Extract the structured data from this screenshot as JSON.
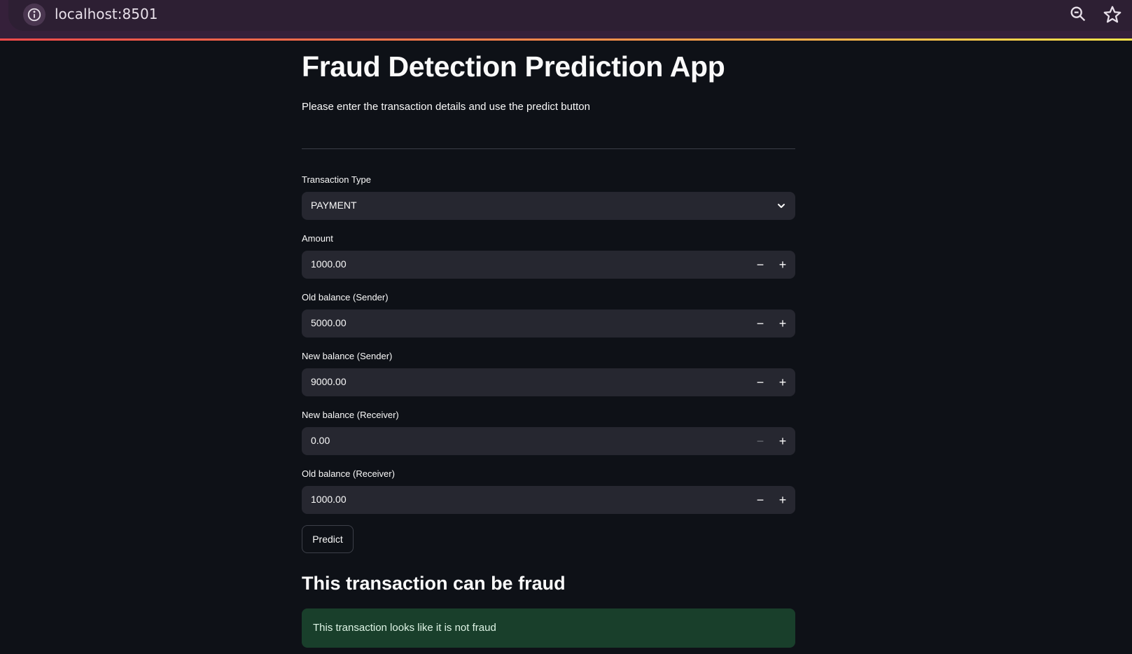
{
  "browser": {
    "url": "localhost:8501"
  },
  "page": {
    "title": "Fraud Detection Prediction App",
    "subtitle": "Please enter the transaction details and use the predict button"
  },
  "form": {
    "transaction_type": {
      "label": "Transaction Type",
      "value": "PAYMENT"
    },
    "amount": {
      "label": "Amount",
      "value": "1000.00"
    },
    "old_balance_sender": {
      "label": "Old balance (Sender)",
      "value": "5000.00"
    },
    "new_balance_sender": {
      "label": "New balance (Sender)",
      "value": "9000.00"
    },
    "new_balance_receiver": {
      "label": "New balance (Receiver)",
      "value": "0.00"
    },
    "old_balance_receiver": {
      "label": "Old balance (Receiver)",
      "value": "1000.00"
    },
    "stepper_minus": "−",
    "stepper_plus": "+"
  },
  "actions": {
    "predict_label": "Predict"
  },
  "result": {
    "heading": "This transaction can be fraud",
    "message": "This transaction looks like it is not fraud"
  },
  "colors": {
    "background": "#0e1117",
    "input_bg": "#262730",
    "success_bg": "#193f2b",
    "browser_bar": "#35203a"
  }
}
